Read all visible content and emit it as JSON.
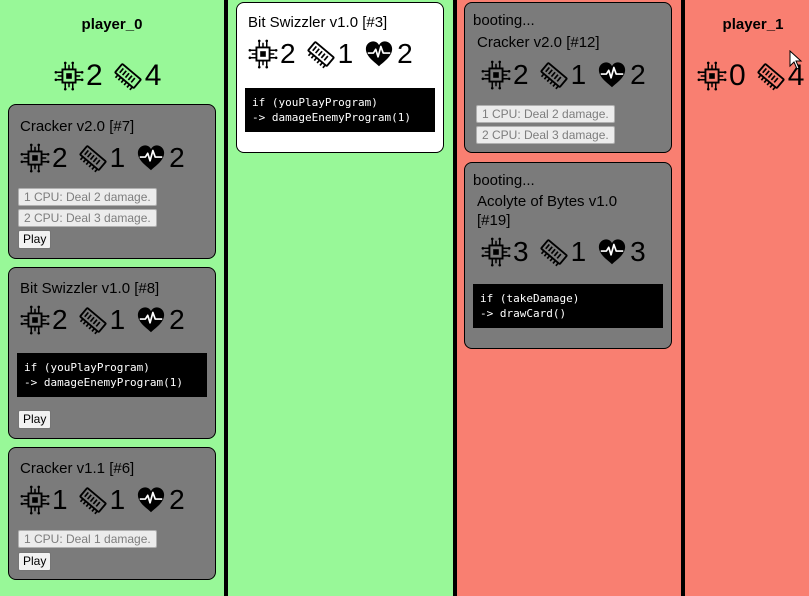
{
  "player0": {
    "name": "player_0",
    "cpu": "2",
    "memory": "4"
  },
  "player1": {
    "name": "player_1",
    "cpu": "0",
    "memory": "4"
  },
  "hand": [
    {
      "title": "Cracker v2.0 [#7]",
      "cpu": "2",
      "mem": "1",
      "hp": "2",
      "abilities": [
        "1 CPU: Deal 2 damage.",
        "2 CPU: Deal 3 damage."
      ],
      "play": "Play"
    },
    {
      "title": "Bit Swizzler v1.0 [#8]",
      "cpu": "2",
      "mem": "1",
      "hp": "2",
      "code": "if (youPlayProgram)\n-> damageEnemyProgram(1)",
      "play": "Play"
    },
    {
      "title": "Cracker v1.1 [#6]",
      "cpu": "1",
      "mem": "1",
      "hp": "2",
      "abilities": [
        "1 CPU: Deal 1 damage."
      ],
      "play": "Play"
    }
  ],
  "board0": [
    {
      "title": "Bit Swizzler v1.0 [#3]",
      "cpu": "2",
      "mem": "1",
      "hp": "2",
      "code": "if (youPlayProgram)\n-> damageEnemyProgram(1)"
    }
  ],
  "board1": [
    {
      "status": "booting...",
      "title": "Cracker v2.0 [#12]",
      "cpu": "2",
      "mem": "1",
      "hp": "2",
      "abilities": [
        "1 CPU: Deal 2 damage.",
        "2 CPU: Deal 3 damage."
      ]
    },
    {
      "status": "booting...",
      "title": "Acolyte of Bytes v1.0 [#19]",
      "cpu": "3",
      "mem": "1",
      "hp": "3",
      "code": "if (takeDamage)\n-> drawCard()"
    }
  ],
  "colors": {
    "friendly": "#98f898",
    "enemy": "#f97f71",
    "card": "#7b7b7b"
  }
}
